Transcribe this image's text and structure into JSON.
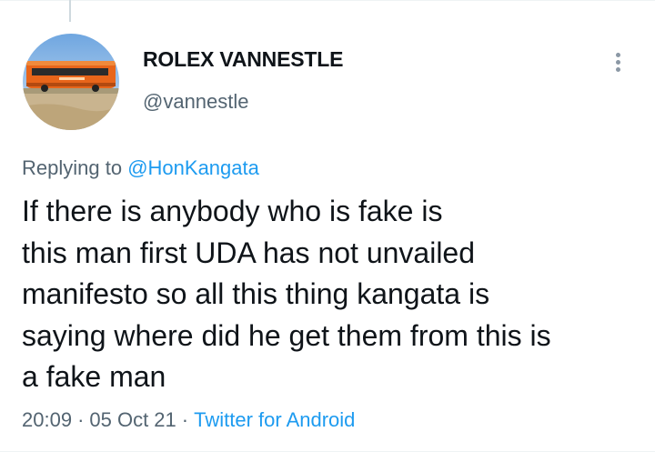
{
  "tweet": {
    "author": {
      "display_name": "ROLEX VANNESTLE",
      "handle": "@vannestle",
      "avatar_icon": "avatar-bus-photo"
    },
    "replying_to_label": "Replying to",
    "replying_to_handle": "@HonKangata",
    "lines": [
      "If there is anybody who is fake is",
      "this man first UDA has not unvailed",
      "manifesto so all this thing kangata is",
      "saying where did he get them from this is",
      "a fake man"
    ],
    "time": "20:09",
    "date": "05 Oct 21",
    "source": "Twitter for Android",
    "separator": "·",
    "more_icon": "more-vertical-icon"
  },
  "colors": {
    "text": "#0f1419",
    "secondary": "#536471",
    "link": "#1d9bf0",
    "thread_line": "#cfd9de"
  }
}
